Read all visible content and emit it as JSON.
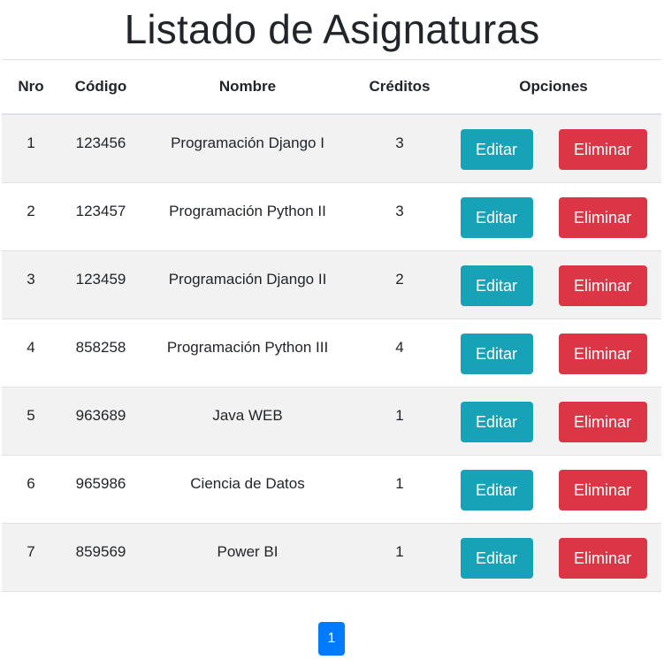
{
  "page": {
    "title": "Listado de Asignaturas"
  },
  "table": {
    "headers": {
      "nro": "Nro",
      "codigo": "Código",
      "nombre": "Nombre",
      "creditos": "Créditos",
      "opciones": "Opciones"
    },
    "rows": [
      {
        "nro": "1",
        "codigo": "123456",
        "nombre": "Programación Django I",
        "creditos": "3",
        "edit": "Editar",
        "delete": "Eliminar"
      },
      {
        "nro": "2",
        "codigo": "123457",
        "nombre": "Programación Python II",
        "creditos": "3",
        "edit": "Editar",
        "delete": "Eliminar"
      },
      {
        "nro": "3",
        "codigo": "123459",
        "nombre": "Programación Django II",
        "creditos": "2",
        "edit": "Editar",
        "delete": "Eliminar"
      },
      {
        "nro": "4",
        "codigo": "858258",
        "nombre": "Programación Python III",
        "creditos": "4",
        "edit": "Editar",
        "delete": "Eliminar"
      },
      {
        "nro": "5",
        "codigo": "963689",
        "nombre": "Java WEB",
        "creditos": "1",
        "edit": "Editar",
        "delete": "Eliminar"
      },
      {
        "nro": "6",
        "codigo": "965986",
        "nombre": "Ciencia de Datos",
        "creditos": "1",
        "edit": "Editar",
        "delete": "Eliminar"
      },
      {
        "nro": "7",
        "codigo": "859569",
        "nombre": "Power BI",
        "creditos": "1",
        "edit": "Editar",
        "delete": "Eliminar"
      }
    ]
  },
  "pagination": {
    "current_page": "1"
  },
  "colors": {
    "edit_button": "#17a2b8",
    "delete_button": "#dc3545",
    "page_active": "#007bff",
    "row_striped": "#f2f2f2"
  }
}
